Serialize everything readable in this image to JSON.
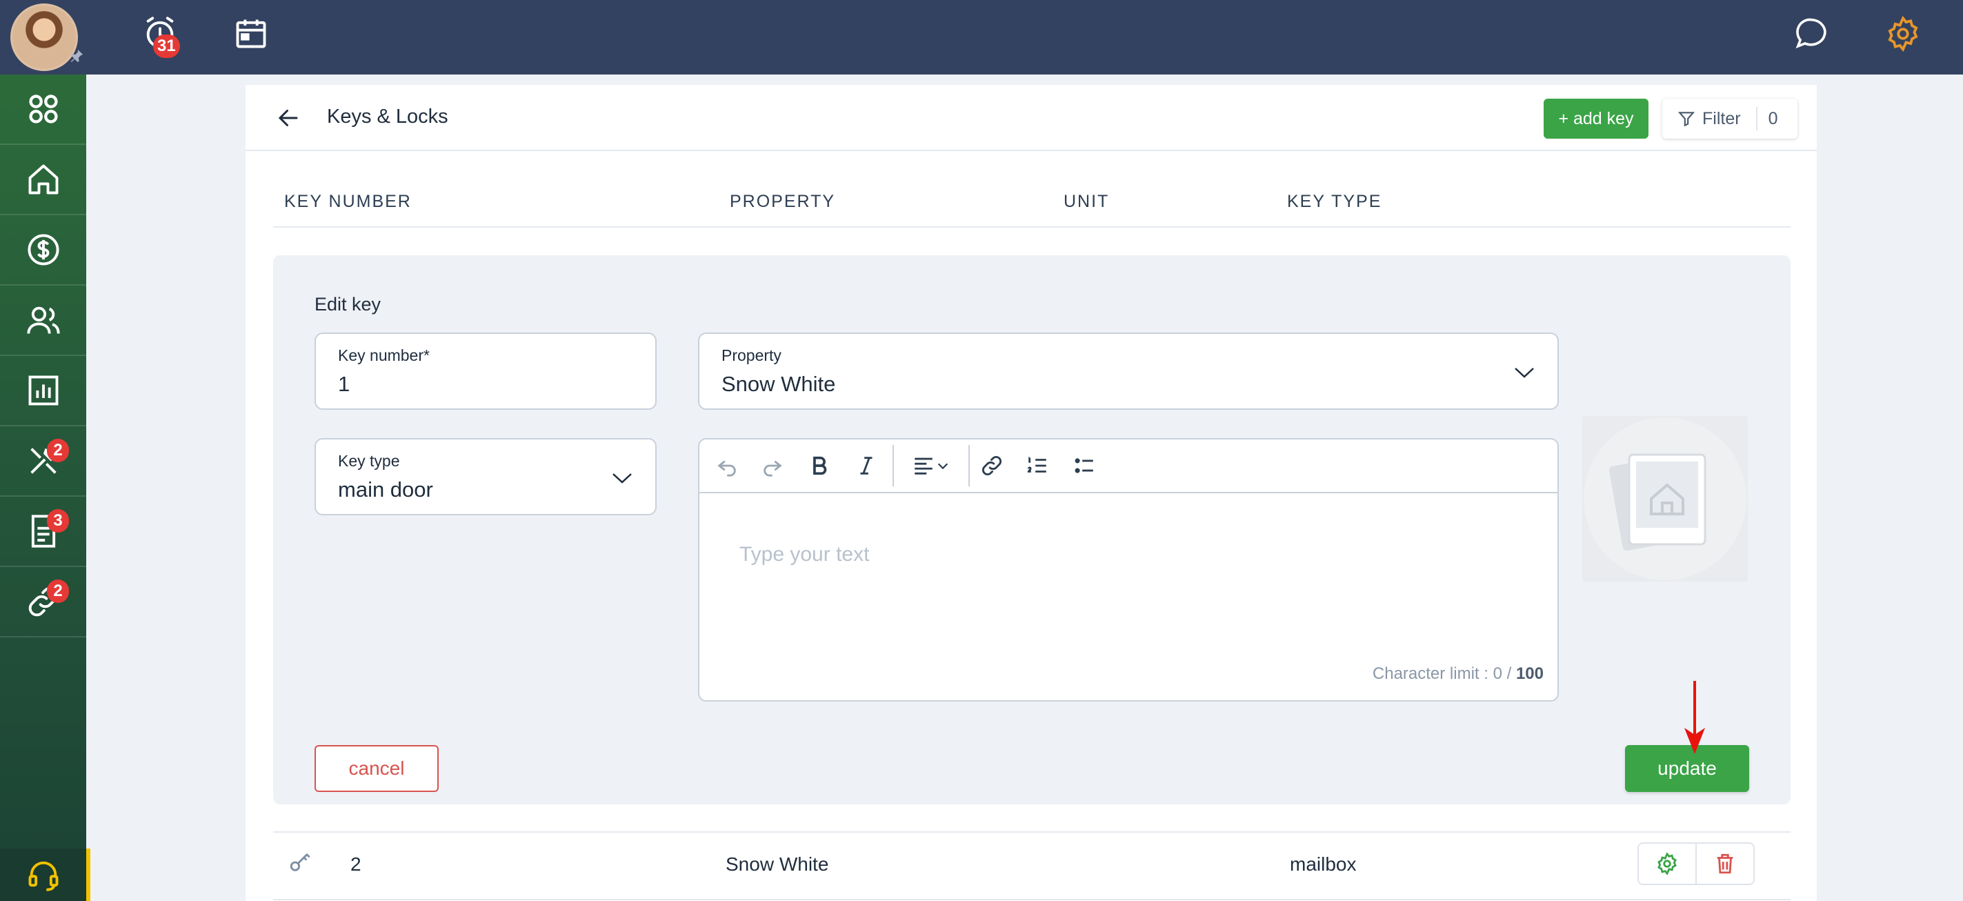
{
  "topbar": {
    "notifications_count": "31",
    "colors": {
      "background": "#334260",
      "settings_icon": "#e8962a"
    }
  },
  "sidebar": {
    "items": [
      {
        "icon": "dashboard-icon"
      },
      {
        "icon": "home-icon"
      },
      {
        "icon": "dollar-icon"
      },
      {
        "icon": "people-icon"
      },
      {
        "icon": "chart-icon"
      },
      {
        "icon": "tools-icon",
        "badge": "2"
      },
      {
        "icon": "document-icon",
        "badge": "3"
      },
      {
        "icon": "link-icon",
        "badge": "2"
      }
    ],
    "help_icon": "headset-icon"
  },
  "page": {
    "title": "Keys & Locks",
    "add_key_label": "+ add key",
    "filter_label": "Filter",
    "filter_count": "0"
  },
  "table": {
    "columns": [
      "KEY NUMBER",
      "PROPERTY",
      "UNIT",
      "KEY TYPE"
    ]
  },
  "edit_form": {
    "title": "Edit key",
    "key_number": {
      "label": "Key number*",
      "value": "1"
    },
    "property": {
      "label": "Property",
      "value": "Snow White"
    },
    "key_type": {
      "label": "Key type",
      "value": "main door"
    },
    "editor": {
      "placeholder": "Type your text",
      "char_limit_prefix": "Character limit : 0 / ",
      "char_limit_max": "100"
    },
    "cancel_label": "cancel",
    "update_label": "update"
  },
  "rows": [
    {
      "key_number": "2",
      "property": "Snow White",
      "unit": "",
      "key_type": "mailbox"
    }
  ],
  "colors": {
    "primary_green": "#3aa447",
    "danger_red": "#d9534f",
    "annotation_arrow": "#e8140c"
  }
}
